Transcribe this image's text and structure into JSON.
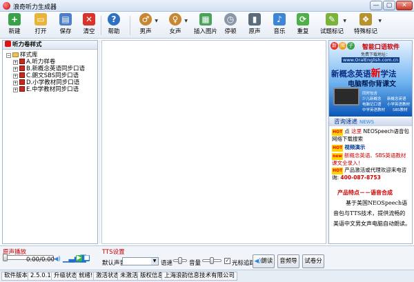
{
  "window": {
    "title": "浪奇听力生成器"
  },
  "toolbar": {
    "new": "新建",
    "open": "打开",
    "save": "保存",
    "clear": "清空",
    "help": "帮助",
    "male": "男声",
    "female": "女声",
    "insert_image": "插入图片",
    "pause": "停顿",
    "original": "原声",
    "music": "音乐",
    "repeat": "重复",
    "test_mark": "试题标记",
    "special_mark": "特殊标记"
  },
  "tree": {
    "header": "听力卷样式",
    "root": "样式库",
    "items": [
      "A.听力样卷",
      "B.新概念英语同步口语",
      "C.朗文SBS同步口语",
      "D.小学教材同步口语",
      "E.中学教材同步口语"
    ]
  },
  "ad": {
    "brand": "智能口语软件",
    "free": "免费下载地址：",
    "url": "www.OralEnglish.com.cn",
    "line1_a": "新概念英语",
    "line1_b": "新",
    "line1_c": "学法",
    "line2": "电脑帮你背课文",
    "features": [
      "同时包含",
      "少儿新概念",
      "新概念英语",
      "电脑记口语",
      "中学英语教材",
      "小学英语教材",
      "SBS教材"
    ]
  },
  "news": {
    "header": "咨询速递",
    "header_en": "NEWS",
    "items": [
      {
        "hot": "HOT",
        "text_a": "点",
        "link": "这里",
        "text_b": "NEOSpeech语音包网络下载搜索"
      },
      {
        "hot": "HOT",
        "link": "视频演示"
      },
      {
        "hot": "new",
        "link": "新概念英语、SBS英语教材课文全录入！"
      },
      {
        "hot": "HOT",
        "text_a": "产品激活或代理欢迎来电咨询:",
        "phone": "400-087-8753"
      }
    ]
  },
  "intro": {
    "heading": "产品特点－－语音合成",
    "body": "基于美国NEOSpeech语音包与TTS技术，提供流畅的美语中文男女声电脑自动朗读。"
  },
  "playback": {
    "title": "原声播放",
    "time": "0:00/0:00"
  },
  "tts": {
    "title": "TTS设置",
    "voice_label": "默认声音",
    "voice_value": "",
    "speed": "语速",
    "volume": "音量",
    "cursor_track": "光标追踪",
    "read": "朗读",
    "export": "音频导出",
    "split": "试卷分离"
  },
  "statusbar": [
    "软件版本",
    "2.5.0.18",
    "升级状态",
    "就绪!",
    "激活状态",
    "未激活",
    "版权信息",
    "上海浪韵信息技术有限公司"
  ]
}
